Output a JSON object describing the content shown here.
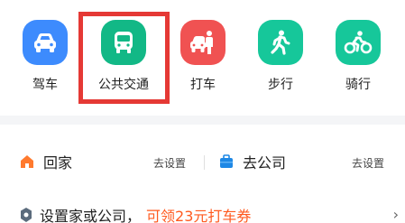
{
  "modes": [
    {
      "label": "驾车",
      "icon": "car-icon",
      "color": "#3d8bfd"
    },
    {
      "label": "公共交通",
      "icon": "bus-icon",
      "color": "#12b886"
    },
    {
      "label": "打车",
      "icon": "taxi-icon",
      "color": "#f05252"
    },
    {
      "label": "步行",
      "icon": "walk-icon",
      "color": "#16c79a"
    },
    {
      "label": "骑行",
      "icon": "bike-icon",
      "color": "#16c79a"
    }
  ],
  "places": {
    "home": {
      "label": "回家",
      "action": "去设置",
      "icon": "home-icon",
      "icon_color": "#ff7a2e"
    },
    "company": {
      "label": "去公司",
      "action": "去设置",
      "icon": "briefcase-icon",
      "icon_color": "#1e88e5"
    }
  },
  "tip": {
    "text": "设置家或公司，",
    "promo": "可领23元打车券",
    "promo_color": "#ff5a1f",
    "icon": "location-pin-icon"
  },
  "highlight_color": "#e53935"
}
